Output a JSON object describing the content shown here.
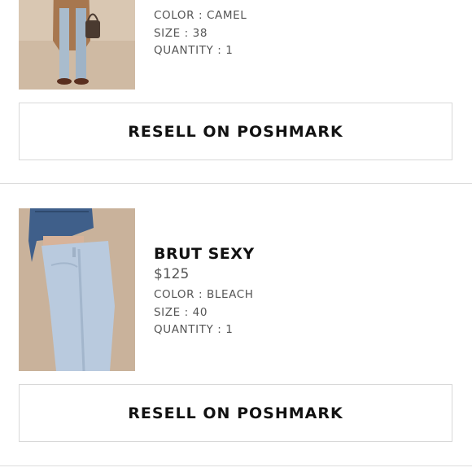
{
  "items": [
    {
      "color": "COLOR : CAMEL",
      "size": "SIZE : 38",
      "quantity": "QUANTITY : 1",
      "button_label": "RESELL ON POSHMARK"
    },
    {
      "title": "BRUT SEXY",
      "price": "$125",
      "color": "COLOR : BLEACH",
      "size": "SIZE : 40",
      "quantity": "QUANTITY : 1",
      "button_label": "RESELL ON POSHMARK"
    }
  ]
}
